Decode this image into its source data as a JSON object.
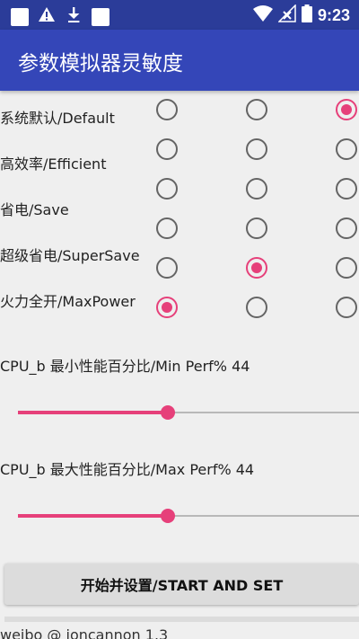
{
  "status_bar": {
    "time": "9:23",
    "icons": [
      "app-notification-icon",
      "warning-icon",
      "download-icon",
      "app-notification-icon",
      "wifi-icon",
      "signal-icon",
      "battery-icon"
    ]
  },
  "app_bar": {
    "title": "参数模拟器灵敏度"
  },
  "options": [
    {
      "label": "系统默认/Default",
      "selected_column": 3
    },
    {
      "label": "高效率/Efficient",
      "selected_column": null
    },
    {
      "label": "省电/Save",
      "selected_column": null
    },
    {
      "label": "超级省电/SuperSave",
      "selected_column": 2
    },
    {
      "label": "火力全开/MaxPower",
      "selected_column": 1
    }
  ],
  "sliders": [
    {
      "label": "CPU_b 最小性能百分比/Min Perf% 44",
      "value_percent": 44
    },
    {
      "label": "CPU_b 最大性能百分比/Max Perf% 44",
      "value_percent": 44
    }
  ],
  "start_button": {
    "label": "开始并设置/START AND SET"
  },
  "footer": {
    "text": "weibo @ ioncannon 1.3"
  },
  "colors": {
    "status_bar": "#2b3c99",
    "app_bar": "#3446b8",
    "accent": "#e6407a",
    "background": "#efefef"
  }
}
